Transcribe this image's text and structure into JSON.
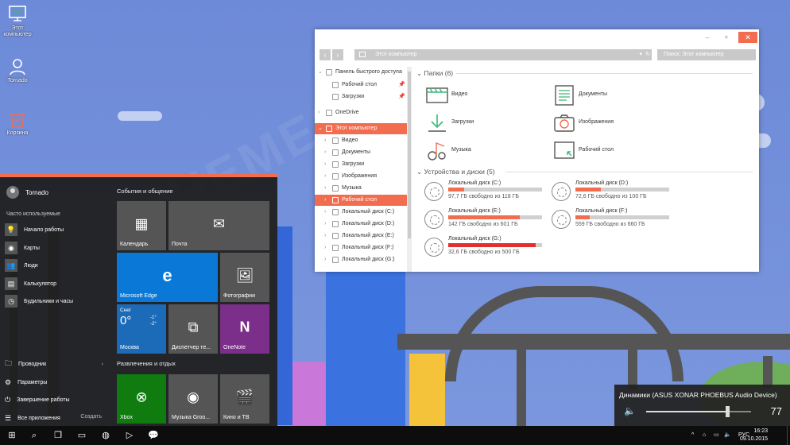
{
  "desktop": {
    "icons": [
      {
        "label": "Этот компьютер",
        "icon": "computer-icon"
      },
      {
        "label": "Tornado",
        "icon": "user-folder-icon"
      },
      {
        "label": "Корзина",
        "icon": "recycle-bin-icon"
      }
    ],
    "watermark": "7THEMES.SU"
  },
  "start_menu": {
    "accent": "#f26d4f",
    "user": "Tornado",
    "frequent_title": "Часто используемые",
    "frequent": [
      {
        "label": "Начало работы",
        "icon": "lightbulb-icon"
      },
      {
        "label": "Карты",
        "icon": "camera-icon"
      },
      {
        "label": "Люди",
        "icon": "people-icon"
      },
      {
        "label": "Калькулятор",
        "icon": "calculator-icon"
      },
      {
        "label": "Будильники и часы",
        "icon": "clock-icon"
      }
    ],
    "bottom": [
      {
        "label": "Проводник",
        "icon": "folder-icon",
        "chevron": "›"
      },
      {
        "label": "Параметры",
        "icon": "gear-icon"
      },
      {
        "label": "Завершение работы",
        "icon": "power-icon"
      },
      {
        "label": "Все приложения",
        "icon": "list-icon"
      }
    ],
    "create_label": "Создать",
    "groups": [
      "События и общение",
      "Развлечения и отдых"
    ],
    "tiles": [
      {
        "label": "Календарь",
        "glyph": "▦",
        "color": "#555555"
      },
      {
        "label": "Почта",
        "glyph": "✉",
        "color": "#555555"
      },
      {
        "label": "Microsoft Edge",
        "glyph": "e",
        "color": "#0a78d7"
      },
      {
        "label": "Фотографии",
        "glyph": "🖼",
        "color": "#555555"
      },
      {
        "label": "Москва",
        "glyph": "",
        "color": "#1c6bb8",
        "temp": "0°",
        "cond": "Снег",
        "hi": "-1°",
        "lo": "-2°"
      },
      {
        "label": "Диспетчер те...",
        "glyph": "⧉",
        "color": "#555555"
      },
      {
        "label": "OneNote",
        "glyph": "N",
        "color": "#7b2f8a"
      },
      {
        "label": "Xbox",
        "glyph": "⊗",
        "color": "#107c10"
      },
      {
        "label": "Музыка Groo...",
        "glyph": "◉",
        "color": "#555555"
      },
      {
        "label": "Кино и ТВ",
        "glyph": "🎬",
        "color": "#555555"
      }
    ]
  },
  "explorer": {
    "address": "Этот компьютер",
    "search_placeholder": "Поиск: Этот компьютер",
    "nav": {
      "back": "‹",
      "forward": "›",
      "dropdown": "▾",
      "refresh": "↻"
    },
    "window_buttons": {
      "min": "–",
      "max": "+",
      "close": "✕"
    },
    "tree": [
      {
        "label": "Панель быстрого доступа",
        "caret": "⌄",
        "icon": "star-icon",
        "indent": 0
      },
      {
        "label": "Рабочий стол",
        "caret": "",
        "icon": "desktop-icon",
        "indent": 1,
        "pin": "📌"
      },
      {
        "label": "Загрузки",
        "caret": "",
        "icon": "download-icon",
        "indent": 1,
        "pin": "📌"
      },
      {
        "label": "OneDrive",
        "caret": "›",
        "icon": "cloud-icon",
        "indent": 0
      },
      {
        "label": "Этот компьютер",
        "caret": "⌄",
        "icon": "computer-icon",
        "indent": 0,
        "selected": true
      },
      {
        "label": "Видео",
        "caret": "›",
        "icon": "video-icon",
        "indent": 1
      },
      {
        "label": "Документы",
        "caret": "›",
        "icon": "document-icon",
        "indent": 1
      },
      {
        "label": "Загрузки",
        "caret": "›",
        "icon": "download-icon",
        "indent": 1
      },
      {
        "label": "Изображения",
        "caret": "›",
        "icon": "image-icon",
        "indent": 1
      },
      {
        "label": "Музыка",
        "caret": "›",
        "icon": "music-icon",
        "indent": 1
      },
      {
        "label": "Рабочий стол",
        "caret": "›",
        "icon": "desktop-icon",
        "indent": 1,
        "selected": true
      },
      {
        "label": "Локальный диск (C:)",
        "caret": "›",
        "icon": "drive-icon",
        "indent": 1
      },
      {
        "label": "Локальный диск (D:)",
        "caret": "›",
        "icon": "drive-icon",
        "indent": 1
      },
      {
        "label": "Локальный диск (E:)",
        "caret": "›",
        "icon": "drive-icon",
        "indent": 1
      },
      {
        "label": "Локальный диск (F:)",
        "caret": "›",
        "icon": "drive-icon",
        "indent": 1
      },
      {
        "label": "Локальный диск (G:)",
        "caret": "›",
        "icon": "drive-icon",
        "indent": 1
      }
    ],
    "folders_header": "Папки (6)",
    "folders": [
      {
        "label": "Видео",
        "icon": "video-icon"
      },
      {
        "label": "Документы",
        "icon": "document-icon"
      },
      {
        "label": "Загрузки",
        "icon": "download-icon"
      },
      {
        "label": "Изображения",
        "icon": "camera-icon"
      },
      {
        "label": "Музыка",
        "icon": "music-icon"
      },
      {
        "label": "Рабочий стол",
        "icon": "desktop-icon"
      }
    ],
    "drives_header": "Устройства и диски (5)",
    "drives": [
      {
        "name": "Локальный диск (C:)",
        "free": "97,7 ГБ свободно из 118 ГБ",
        "used_fraction": 0.17,
        "color": "#f26d4f"
      },
      {
        "name": "Локальный диск (D:)",
        "free": "72,6 ГБ свободно из 100 ГБ",
        "used_fraction": 0.27,
        "color": "#f26d4f"
      },
      {
        "name": "Локальный диск (E:)",
        "free": "142 ГБ свободно из 601 ГБ",
        "used_fraction": 0.76,
        "color": "#f26d4f"
      },
      {
        "name": "Локальный диск (F:)",
        "free": "559 ГБ свободно из 660 ГБ",
        "used_fraction": 0.15,
        "color": "#f26d4f"
      },
      {
        "name": "Локальный диск (G:)",
        "free": "32,6 ГБ свободно из 500 ГБ",
        "used_fraction": 0.93,
        "color": "#e03030"
      }
    ]
  },
  "volume": {
    "device": "Динамики (ASUS XONAR PHOEBUS Audio Device)",
    "level": 77,
    "level_text": "77",
    "speaker_icon": "🔈"
  },
  "taskbar": {
    "buttons": [
      {
        "name": "start-button",
        "glyph": "⊞"
      },
      {
        "name": "search-button",
        "glyph": "⌕"
      },
      {
        "name": "task-view-button",
        "glyph": "❐"
      },
      {
        "name": "file-explorer-button",
        "glyph": "▭"
      },
      {
        "name": "chrome-button",
        "glyph": "◍"
      },
      {
        "name": "media-player-button",
        "glyph": "▷"
      },
      {
        "name": "feedback-button",
        "glyph": "💬"
      }
    ],
    "tray_icons": [
      "^",
      "⌂",
      "▭",
      "🔈"
    ],
    "language": "РУС",
    "time": "16:23",
    "date": "09.10.2015"
  }
}
